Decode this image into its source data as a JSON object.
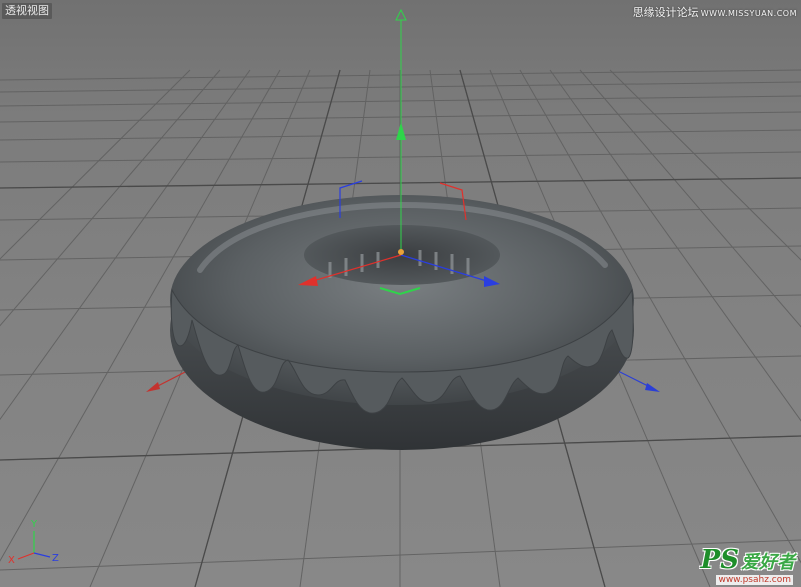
{
  "viewport": {
    "label": "透视视图"
  },
  "watermarks": {
    "top": {
      "site": "思缘设计论坛",
      "url": "WWW.MISSYUAN.COM"
    },
    "bottom": {
      "logo": "PS",
      "logo_cn": "爱好者",
      "url": "www.psahz.com"
    }
  },
  "axis_indicator": {
    "y": "Y",
    "x": "X",
    "z": "Z"
  },
  "colors": {
    "x_axis": "#e0312c",
    "y_axis": "#2fd44a",
    "z_axis": "#2a3ee0",
    "background": "#7a7a7a",
    "grid": "#5c5c5c",
    "donut": "#5e6366"
  },
  "scene_objects": [
    "torus-donut-mesh",
    "move-gizmo",
    "floor-grid"
  ]
}
